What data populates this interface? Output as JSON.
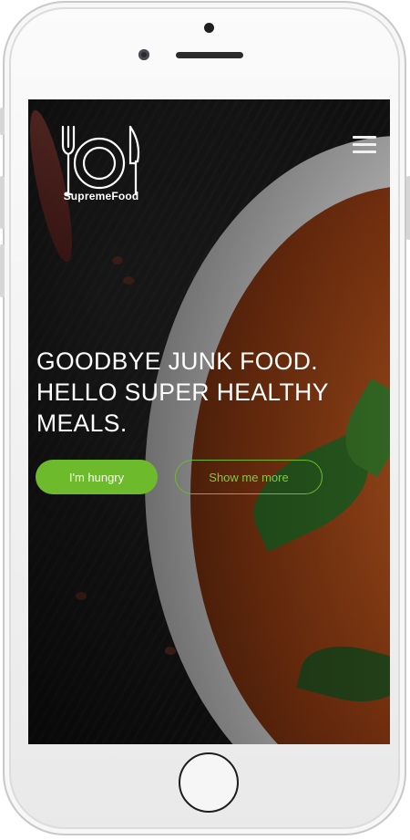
{
  "brand": {
    "name": "SupremeFood",
    "logo_icon": "plate-fork-knife-icon"
  },
  "nav": {
    "menu_icon": "hamburger-menu-icon"
  },
  "hero": {
    "headline_line1": "GOODBYE JUNK FOOD.",
    "headline_line2": "HELLO SUPER HEALTHY",
    "headline_line3": "MEALS.",
    "primary_button": "I'm hungry",
    "secondary_button": "Show me more"
  },
  "colors": {
    "accent": "#6dbb2c",
    "text": "#ffffff"
  }
}
